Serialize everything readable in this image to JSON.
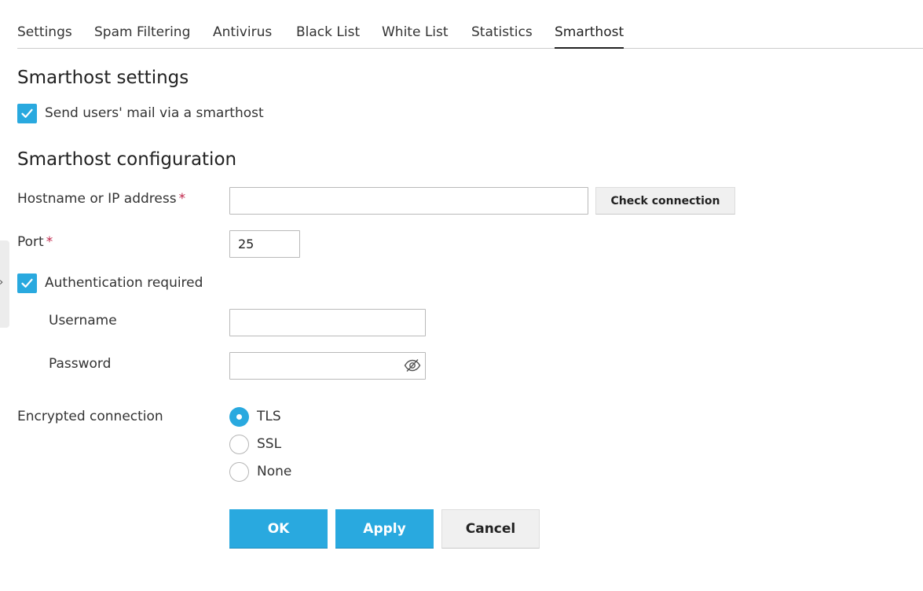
{
  "tabs": [
    {
      "label": "Settings"
    },
    {
      "label": "Spam Filtering"
    },
    {
      "label": "Antivirus"
    },
    {
      "label": "Black List"
    },
    {
      "label": "White List"
    },
    {
      "label": "Statistics"
    },
    {
      "label": "Smarthost",
      "active": true
    }
  ],
  "settings": {
    "heading": "Smarthost settings",
    "send_via_smarthost_label": "Send users' mail via a smarthost",
    "send_via_smarthost_checked": true
  },
  "config": {
    "heading": "Smarthost configuration",
    "hostname_label": "Hostname or IP address",
    "hostname_value": "",
    "required_mark": "*",
    "check_connection_label": "Check connection",
    "port_label": "Port",
    "port_value": "25",
    "auth_label": "Authentication required",
    "auth_checked": true,
    "username_label": "Username",
    "username_value": "",
    "password_label": "Password",
    "password_value": "",
    "encryption_label": "Encrypted connection",
    "encryption_options": [
      {
        "label": "TLS",
        "checked": true
      },
      {
        "label": "SSL",
        "checked": false
      },
      {
        "label": "None",
        "checked": false
      }
    ]
  },
  "buttons": {
    "ok": "OK",
    "apply": "Apply",
    "cancel": "Cancel"
  },
  "side_handle": {
    "glyph": "›"
  },
  "colors": {
    "accent": "#29a9df",
    "required": "#c0264b"
  },
  "icons": {
    "checkbox": "checkmark-icon",
    "password_toggle": "eye-slash-icon"
  }
}
